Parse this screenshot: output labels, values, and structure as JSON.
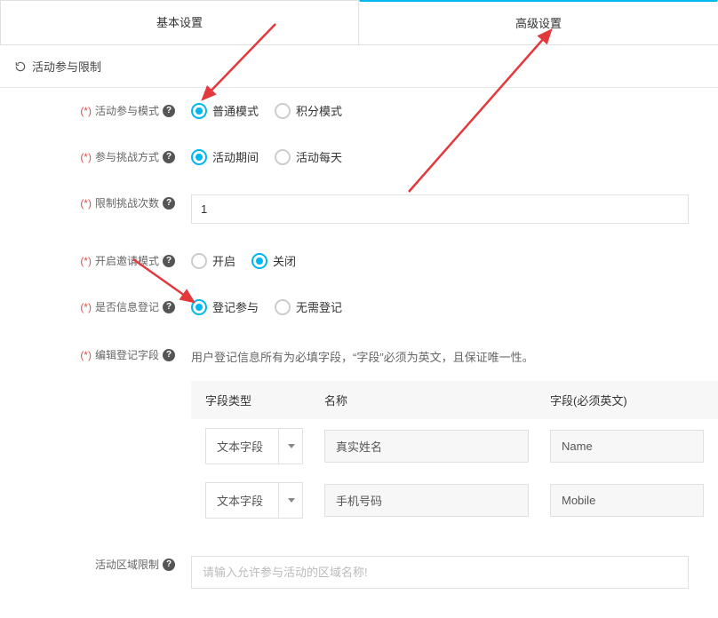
{
  "tabs": {
    "basic": "基本设置",
    "advanced": "高级设置"
  },
  "section": {
    "title": "活动参与限制"
  },
  "rows": {
    "mode": {
      "label": "活动参与模式",
      "opts": [
        "普通模式",
        "积分模式"
      ]
    },
    "method": {
      "label": "参与挑战方式",
      "opts": [
        "活动期间",
        "活动每天"
      ]
    },
    "limit": {
      "label": "限制挑战次数",
      "value": "1"
    },
    "invite": {
      "label": "开启邀请模式",
      "opts": [
        "开启",
        "关闭"
      ]
    },
    "reg": {
      "label": "是否信息登记",
      "opts": [
        "登记参与",
        "无需登记"
      ]
    },
    "fields": {
      "label": "编辑登记字段",
      "desc": "用户登记信息所有为必填字段，“字段”必须为英文，且保证唯一性。",
      "headers": {
        "type": "字段类型",
        "name": "名称",
        "field": "字段(必须英文)"
      },
      "typeOption": "文本字段",
      "items": [
        {
          "name": "真实姓名",
          "field": "Name"
        },
        {
          "name": "手机号码",
          "field": "Mobile"
        }
      ]
    },
    "area": {
      "label": "活动区域限制",
      "placeholder": "请输入允许参与活动的区域名称!"
    }
  },
  "reqMark": "(*)"
}
